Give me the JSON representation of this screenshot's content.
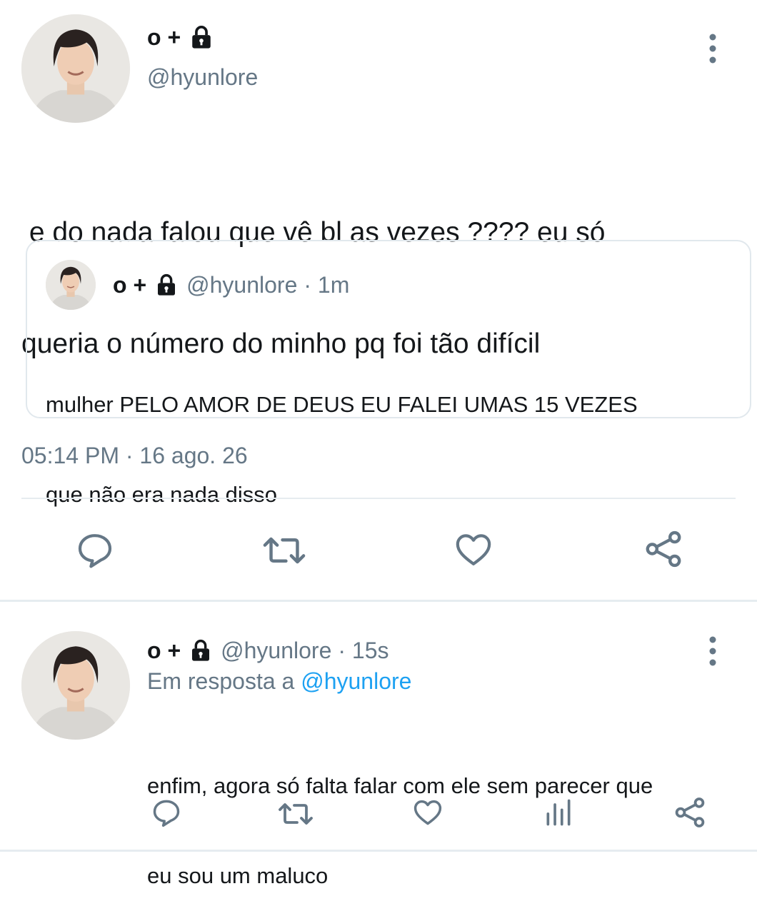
{
  "main_tweet": {
    "display_name": "o +",
    "handle": "@hyunlore",
    "text_line1": " e do nada falou que vê bl as vezes ???? eu só",
    "text_line2": "queria o número do minho pq foi tão difícil",
    "timestamp": "05:14 PM · 16 ago. 26",
    "more_icon": "more-vertical-icon",
    "lock_icon": "lock-icon"
  },
  "quoted_tweet": {
    "display_name": "o +",
    "handle": "@hyunlore",
    "time": "· 1m",
    "text_line1": "mulher PELO AMOR DE DEUS EU FALEI UMAS 15 VEZES",
    "text_line2": "que não era nada disso"
  },
  "main_actions": [
    "reply-icon",
    "retweet-icon",
    "like-icon",
    "share-icon"
  ],
  "reply_tweet": {
    "display_name": "o +",
    "handle": "@hyunlore",
    "time": "· 15s",
    "replying_to_prefix": "Em resposta a",
    "replying_to_handle": "@hyunlore",
    "text_line1": "enfim, agora só falta falar com ele sem parecer que",
    "text_line2": "eu sou um maluco"
  },
  "reply_actions": [
    "reply-icon",
    "retweet-icon",
    "like-icon",
    "analytics-icon",
    "share-icon"
  ],
  "colors": {
    "link": "#1da1f2",
    "muted": "#657786",
    "icon": "#657786",
    "divider": "#e6ecf0"
  }
}
